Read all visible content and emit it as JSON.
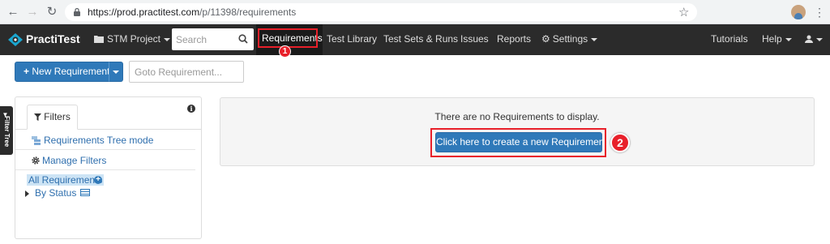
{
  "browser": {
    "url_host": "https://prod.practitest.com",
    "url_path": "/p/11398/requirements"
  },
  "app": {
    "logo_text": "PractiTest",
    "project_menu": "STM Project",
    "search_placeholder": "Search",
    "nav_items": [
      "Requirements",
      "Test Library",
      "Test Sets & Runs",
      "Issues",
      "Reports",
      "Settings"
    ],
    "right_nav": [
      "Tutorials",
      "Help"
    ]
  },
  "toolbar": {
    "new_requirement_label": "New Requirement",
    "goto_placeholder": "Goto Requirement..."
  },
  "side_tab": {
    "label": "Filter Tree"
  },
  "filters": {
    "tab_label": "Filters",
    "tree_mode_label": "Requirements Tree mode",
    "manage_filters_label": "Manage Filters",
    "all_requirements_label": "All Requirements",
    "by_status_label": "By Status"
  },
  "main": {
    "empty_message": "There are no Requirements to display.",
    "create_button_label": "Click here to create a new Requirement"
  },
  "annotations": {
    "callout_1": "1",
    "callout_2": "2",
    "highlight_color": "#e8202a"
  },
  "colors": {
    "nav_bg": "#2b2b2b",
    "primary_button": "#2f79b9",
    "link": "#2f6fae"
  }
}
